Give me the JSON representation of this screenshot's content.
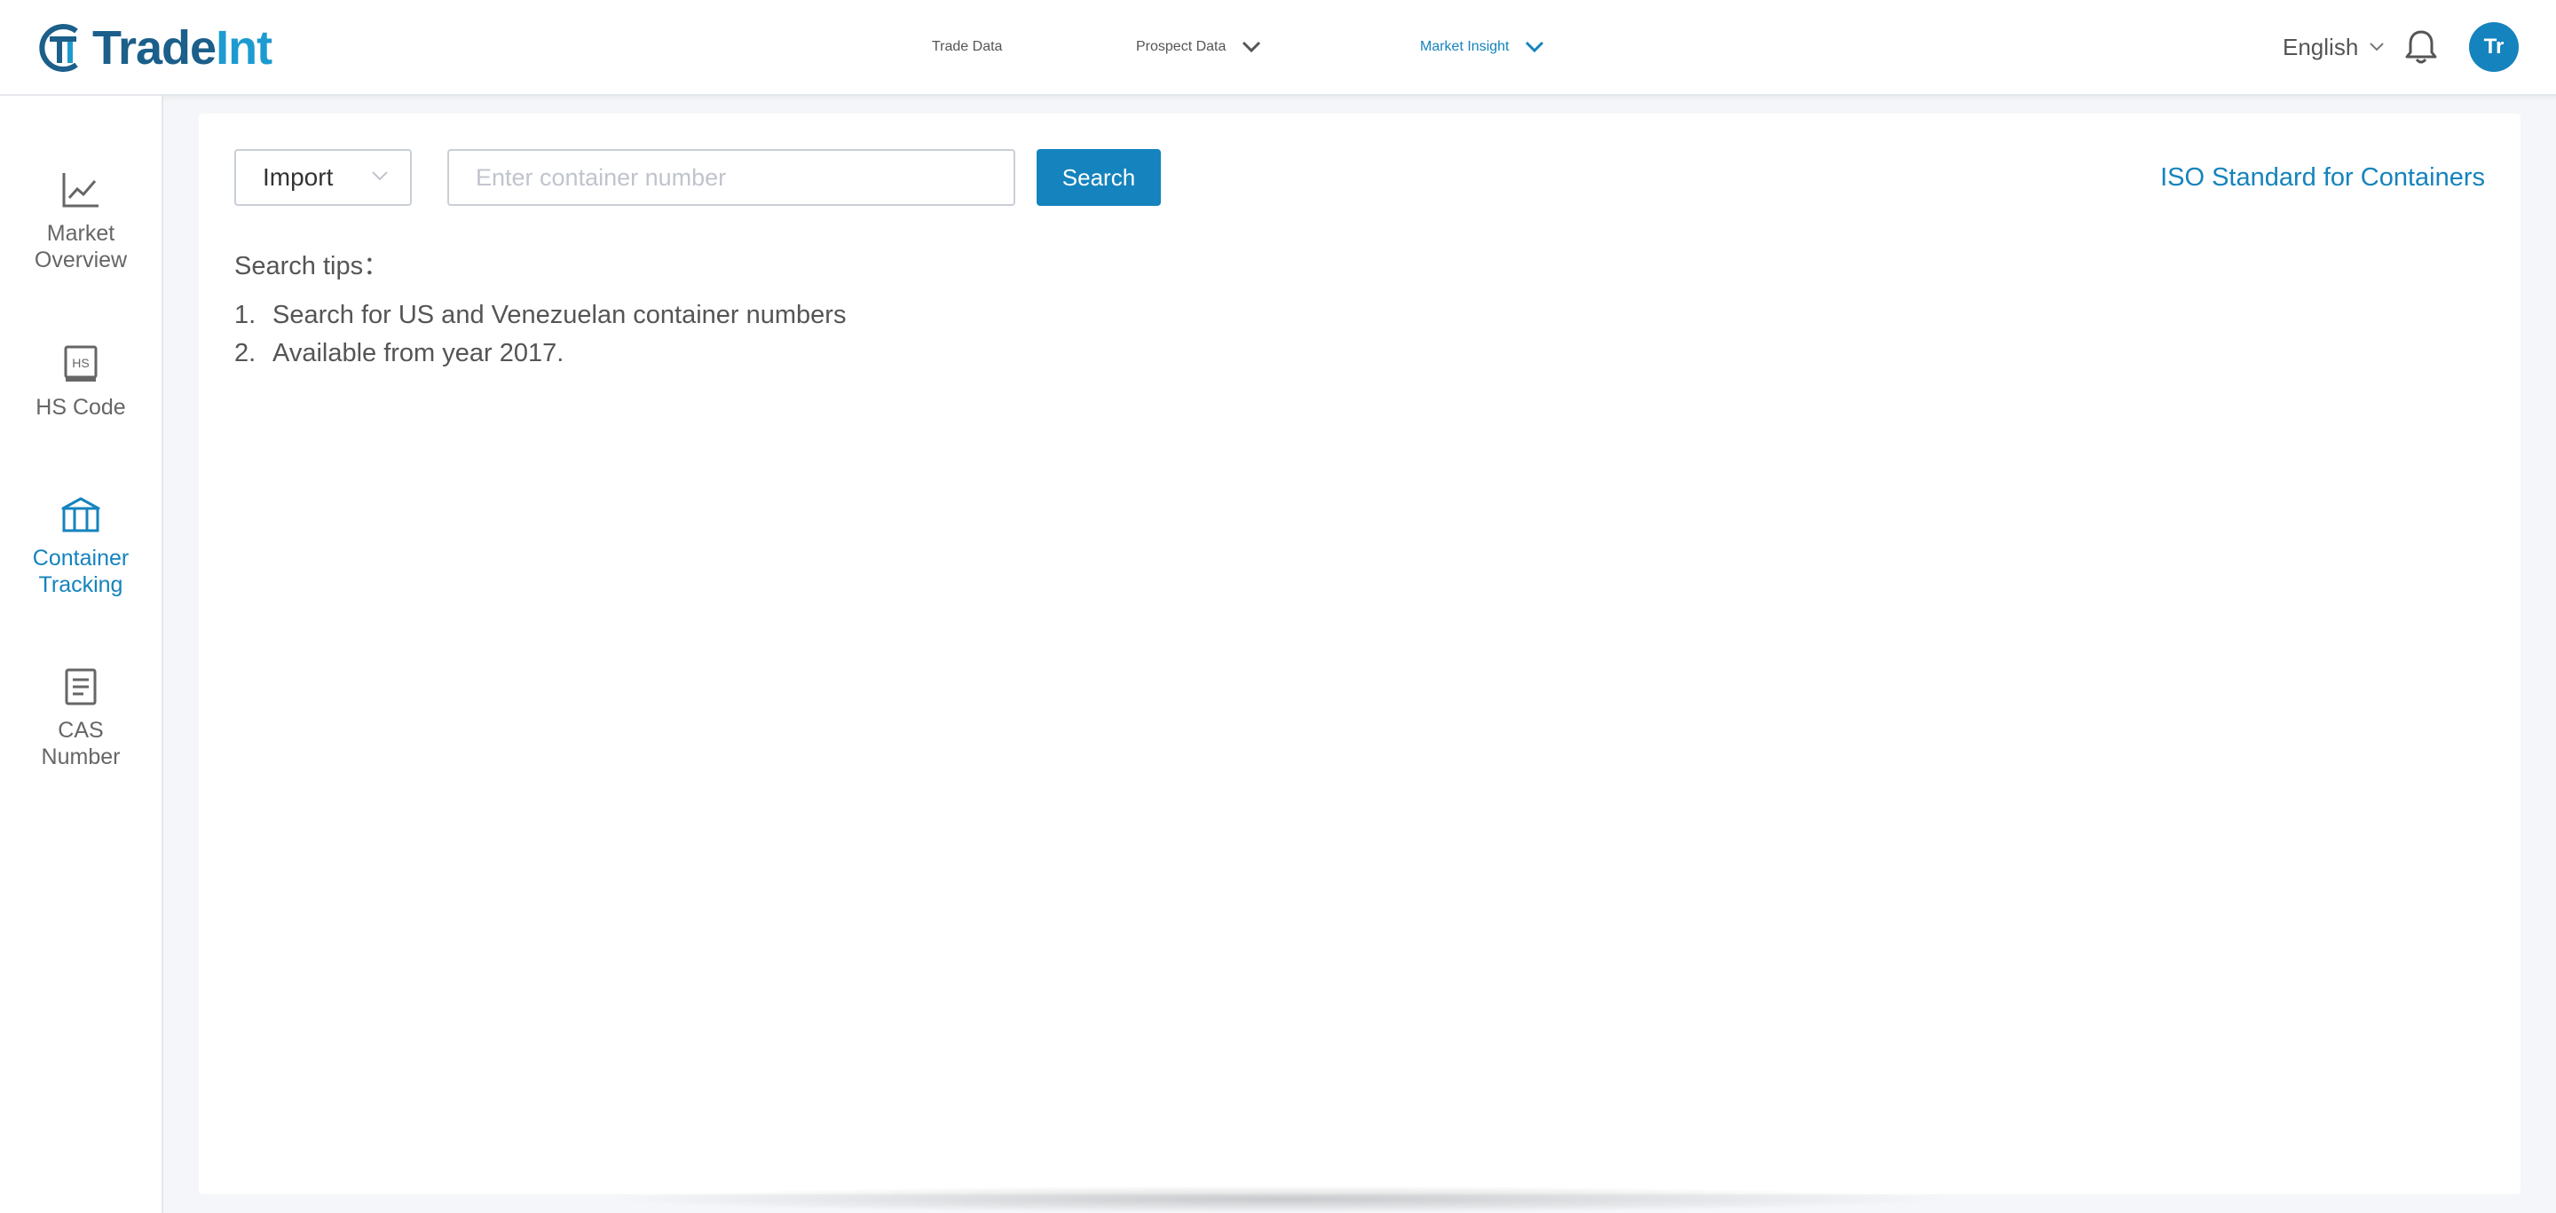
{
  "app": {
    "logo_part1": "Trade",
    "logo_part2": "Int",
    "brand_color": "#1583bd"
  },
  "nav": {
    "items": [
      {
        "label": "Trade Data",
        "dropdown": false,
        "active": false
      },
      {
        "label": "Prospect Data",
        "dropdown": true,
        "active": false
      },
      {
        "label": "Market Insight",
        "dropdown": true,
        "active": true
      }
    ]
  },
  "header": {
    "language": "English",
    "avatar_initials": "Tr"
  },
  "sidebar": {
    "items": [
      {
        "label_line1": "Market",
        "label_line2": "Overview",
        "icon": "line-chart-icon",
        "active": false
      },
      {
        "label_line1": "HS Code",
        "label_line2": "",
        "icon": "hs-code-icon",
        "active": false
      },
      {
        "label_line1": "Container",
        "label_line2": "Tracking",
        "icon": "container-icon",
        "active": true
      },
      {
        "label_line1": "CAS",
        "label_line2": "Number",
        "icon": "document-icon",
        "active": false
      }
    ]
  },
  "search": {
    "direction": "Import",
    "placeholder": "Enter container number",
    "value": "",
    "button_label": "Search",
    "iso_link": "ISO Standard for Containers"
  },
  "tips": {
    "title": "Search tips：",
    "items": [
      {
        "num": "1.",
        "text": "Search for US and Venezuelan container numbers"
      },
      {
        "num": "2.",
        "text": "Available from year 2017."
      }
    ]
  }
}
